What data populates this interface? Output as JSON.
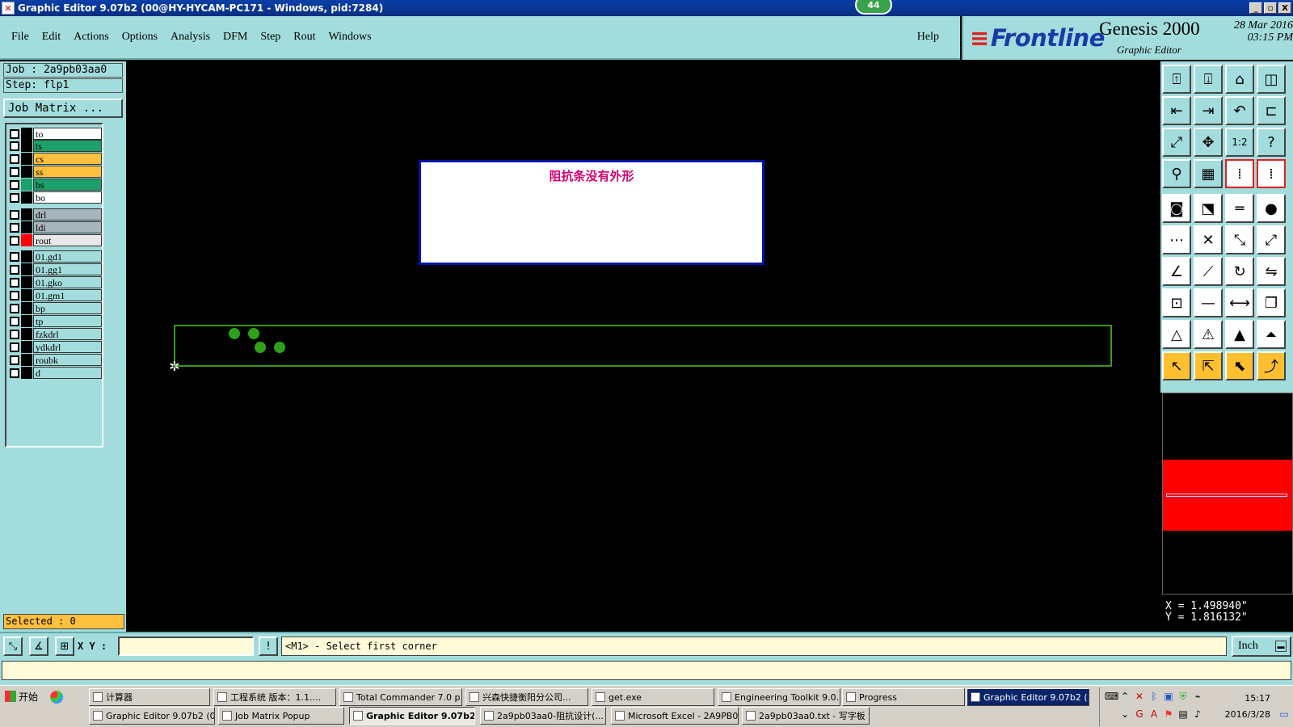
{
  "window": {
    "title": "Graphic Editor 9.07b2 (00@HY-HYCAM-PC171 - Windows, pid:7284)",
    "badge": "44",
    "btn_min": "_",
    "btn_max": "▫",
    "btn_close": "X"
  },
  "menu": {
    "items": [
      "File",
      "Edit",
      "Actions",
      "Options",
      "Analysis",
      "DFM",
      "Step",
      "Rout",
      "Windows"
    ],
    "help": "Help"
  },
  "logo": {
    "brand": "Frontline",
    "product": "Genesis 2000",
    "subtitle": "Graphic Editor",
    "date": "28 Mar 2016",
    "time": "03:15 PM"
  },
  "left": {
    "job": "Job : 2a9pb03aa0",
    "step": "Step: flp1",
    "job_matrix": "Job Matrix ...",
    "selected": "Selected : 0",
    "layers": [
      {
        "name": "to",
        "color": "#ffffff",
        "stat": "#000000"
      },
      {
        "name": "ts",
        "color": "#1aa068",
        "stat": "#000000"
      },
      {
        "name": "cs",
        "color": "#ffc040",
        "stat": "#000000"
      },
      {
        "name": "ss",
        "color": "#ffc040",
        "stat": "#000000"
      },
      {
        "name": "bs",
        "color": "#1aa068",
        "stat": "#1aa068"
      },
      {
        "name": "bo",
        "color": "#ffffff",
        "stat": "#000000"
      },
      {
        "name": "drl",
        "color": "#a8b4bc",
        "stat": "#000000"
      },
      {
        "name": "ldi",
        "color": "#a8b4bc",
        "stat": "#000000"
      },
      {
        "name": "rout",
        "color": "#e8e8e8",
        "stat": "#ff0000"
      },
      {
        "name": "01.gd1",
        "color": "#a3dcdc",
        "stat": "#000000"
      },
      {
        "name": "01.gg1",
        "color": "#a3dcdc",
        "stat": "#000000"
      },
      {
        "name": "01.gko",
        "color": "#a3dcdc",
        "stat": "#000000"
      },
      {
        "name": "01.gm1",
        "color": "#a3dcdc",
        "stat": "#000000"
      },
      {
        "name": "bp",
        "color": "#a3dcdc",
        "stat": "#000000"
      },
      {
        "name": "tp",
        "color": "#a3dcdc",
        "stat": "#000000"
      },
      {
        "name": "fzkdrl",
        "color": "#a3dcdc",
        "stat": "#000000"
      },
      {
        "name": "ydkdrl",
        "color": "#a3dcdc",
        "stat": "#000000"
      },
      {
        "name": "roubk",
        "color": "#a3dcdc",
        "stat": "#000000"
      },
      {
        "name": "d",
        "color": "#a3dcdc",
        "stat": "#000000"
      }
    ]
  },
  "canvas": {
    "message": "阻抗条没有外形"
  },
  "coords": {
    "x": "X = 1.498940\"",
    "y": "Y = 1.816132\""
  },
  "cmdbar": {
    "xy_label": "X Y :",
    "xy_value": "",
    "prompt": "<M1> - Select first corner",
    "units": "Inch",
    "units_dd": "▬"
  },
  "taskbar": {
    "start": "开始",
    "row1": [
      {
        "label": "计算器"
      },
      {
        "label": "工程系统  版本：1.1...."
      },
      {
        "label": "Total Commander 7.0 p..."
      },
      {
        "label": "兴森快捷衡阳分公司..."
      },
      {
        "label": "get.exe"
      },
      {
        "label": "Engineering Toolkit 9.0..."
      },
      {
        "label": "Progress"
      },
      {
        "label": "Graphic Editor 9.07b2 (..."
      }
    ],
    "row2": [
      {
        "label": "Graphic Editor 9.07b2 (0..."
      },
      {
        "label": "Job Matrix Popup"
      },
      {
        "label": "Graphic Editor 9.07b2 ..."
      },
      {
        "label": "2a9pb03aa0-阻抗设计(..."
      },
      {
        "label": "Microsoft Excel - 2A9PB0..."
      },
      {
        "label": "2a9pb03aa0.txt - 写字板"
      }
    ],
    "time": "15:17",
    "date": "2016/3/28"
  },
  "colors": {
    "panel": "#a3dcdc",
    "outline": "#3a9a1a",
    "pad": "#2ea01a",
    "message_border": "#0014a8",
    "message_text": "#d4006e"
  }
}
